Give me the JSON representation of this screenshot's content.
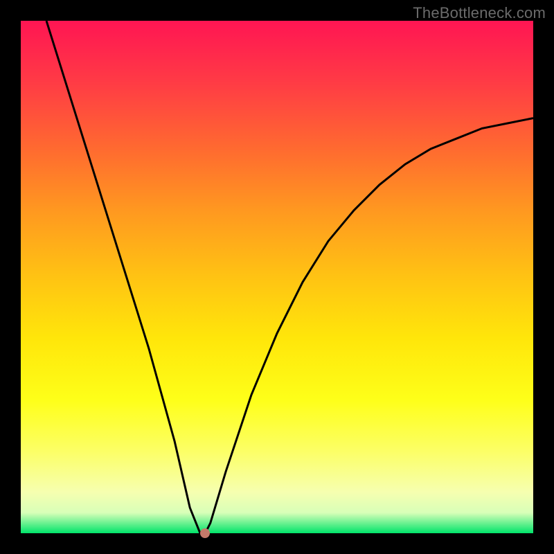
{
  "watermark": "TheBottleneck.com",
  "colors": {
    "frame": "#000000",
    "curve": "#000000",
    "dot": "#c47a6a",
    "gradient_top": "#ff1553",
    "gradient_bottom": "#00e46a"
  },
  "chart_data": {
    "type": "line",
    "title": "",
    "xlabel": "",
    "ylabel": "",
    "xlim": [
      0,
      100
    ],
    "ylim": [
      0,
      100
    ],
    "background": "vertical-gradient red→orange→yellow→green",
    "series": [
      {
        "name": "bottleneck-curve",
        "x": [
          5,
          10,
          15,
          20,
          25,
          30,
          33,
          35,
          36,
          37,
          40,
          45,
          50,
          55,
          60,
          65,
          70,
          75,
          80,
          85,
          90,
          95,
          100
        ],
        "y": [
          100,
          84,
          68,
          52,
          36,
          18,
          5,
          0,
          0,
          2,
          12,
          27,
          39,
          49,
          57,
          63,
          68,
          72,
          75,
          77,
          79,
          80,
          81
        ]
      }
    ],
    "marker": {
      "x": 36,
      "y": 0
    },
    "grid": false,
    "legend": false
  }
}
